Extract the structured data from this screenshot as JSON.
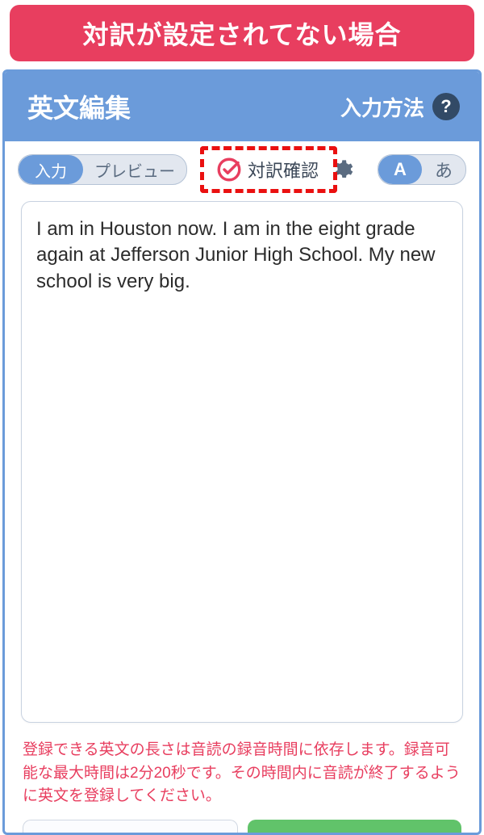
{
  "banner": {
    "text": "対訳が設定されてない場合"
  },
  "header": {
    "title": "英文編集",
    "help_label": "入力方法",
    "help_icon_char": "?"
  },
  "toolbar": {
    "tab_input": "入力",
    "tab_preview": "プレビュー",
    "check_label": "対訳確認",
    "font_a": "A",
    "font_ja": "あ"
  },
  "editor": {
    "text": "I am in Houston now. I am in the eight grade again at Jefferson Junior High School. My new school is very big."
  },
  "footer": {
    "note": "登録できる英文の長さは音読の録音時間に依存します。録音可能な最大時間は2分20秒です。その時間内に音読が終了するように英文を登録してください。"
  }
}
